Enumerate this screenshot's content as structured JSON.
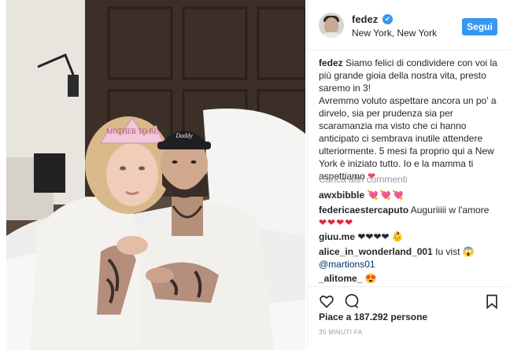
{
  "header": {
    "username": "fedez",
    "verified_icon": "✔",
    "location": "New York, New York",
    "follow_label": "Segui"
  },
  "caption": {
    "username": "fedez",
    "text_1": "Siamo felici di condividere con voi la più grande gioia della nostra vita, presto saremo in 3!",
    "text_2": "Avremmo voluto aspettare ancora un po' a dirvelo, sia per prudenza sia per scaramanzia ma visto che ci hanno anticipato ci sembrava inutile attendere ulteriormente. 5 mesi fa proprio qui a New York è iniziato tutto. Io e la mamma ti aspettiamo",
    "heart": "❤"
  },
  "load_more_label": "Carica altri commenti",
  "comments": [
    {
      "username": "awxbibble",
      "text": "",
      "emoji": "💘💘💘"
    },
    {
      "username": "federicaestercaputo",
      "text": "Augur​iiiii w l'amore",
      "emoji": "❤❤❤❤"
    },
    {
      "username": "giuu.me",
      "text": "❤❤❤❤",
      "emoji": "👶"
    },
    {
      "username": "alice_in_wonderland_001",
      "text": "Iu vist",
      "emoji": "😱",
      "mention": "@martions01"
    },
    {
      "username": "_alitome_",
      "text": "",
      "emoji": "😍"
    }
  ],
  "photo": {
    "crown_text": "MOTHER TO BE",
    "cap_text": "Daddy"
  },
  "actions": {
    "like_icon": "heart-outline",
    "comment_icon": "speech-bubble",
    "save_icon": "bookmark"
  },
  "likes_text": "Piace a 187.292 persone",
  "timestamp": "35 MINUTI FA",
  "colors": {
    "accent": "#3897f0",
    "text": "#262626",
    "muted": "#999999",
    "mention": "#003569",
    "heart": "#ed4956"
  }
}
